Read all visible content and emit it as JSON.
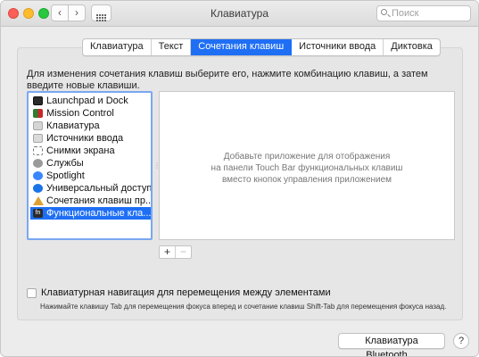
{
  "window": {
    "title": "Клавиатура"
  },
  "search": {
    "placeholder": "Поиск"
  },
  "tabs": [
    {
      "label": "Клавиатура",
      "active": false
    },
    {
      "label": "Текст",
      "active": false
    },
    {
      "label": "Сочетания клавиш",
      "active": true
    },
    {
      "label": "Источники ввода",
      "active": false
    },
    {
      "label": "Диктовка",
      "active": false
    }
  ],
  "description": "Для изменения сочетания клавиш выберите его, нажмите комбинацию клавиш, а затем введите новые клавиши.",
  "categories": [
    {
      "label": "Launchpad и Dock",
      "icon": "launchpad-icon"
    },
    {
      "label": "Mission Control",
      "icon": "mission-control-icon"
    },
    {
      "label": "Клавиатура",
      "icon": "keyboard-icon"
    },
    {
      "label": "Источники ввода",
      "icon": "input-sources-icon"
    },
    {
      "label": "Снимки экрана",
      "icon": "screenshot-icon"
    },
    {
      "label": "Службы",
      "icon": "gear-icon"
    },
    {
      "label": "Spotlight",
      "icon": "spotlight-icon"
    },
    {
      "label": "Универсальный доступ",
      "icon": "accessibility-icon"
    },
    {
      "label": "Сочетания клавиш пр...",
      "icon": "app-shortcuts-icon"
    },
    {
      "label": "Функциональные кла...",
      "icon": "fn-icon",
      "selected": true
    }
  ],
  "detail": {
    "message_line1": "Добавьте приложение для отображения",
    "message_line2": "на панели Touch Bar функциональных клавиш",
    "message_line3": "вместо кнопок управления приложением"
  },
  "add_remove": {
    "add": "+",
    "remove": "−"
  },
  "keyboard_navigation": {
    "label": "Клавиатурная навигация для перемещения между элементами",
    "checked": false,
    "note": "Нажимайте клавишу Tab для перемещения фокуса вперед и сочетание клавиш Shift-Tab для перемещения фокуса назад."
  },
  "bluetooth_button": "Клавиатура Bluetooth…",
  "help_button": "?"
}
